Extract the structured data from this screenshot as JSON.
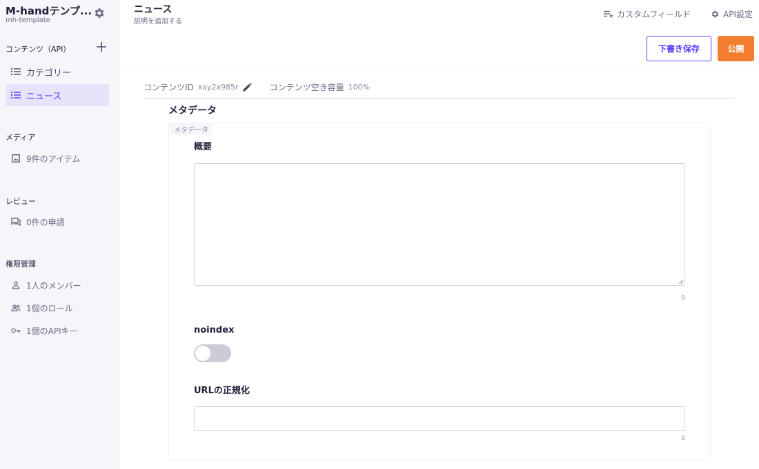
{
  "service": {
    "name": "M-handテンプ...",
    "id": "mh-template"
  },
  "sidebar": {
    "contents_heading": "コンテンツ（API）",
    "contents": [
      {
        "label": "カテゴリー",
        "icon": "list-icon"
      },
      {
        "label": "ニュース",
        "icon": "list-icon",
        "active": true
      }
    ],
    "media_heading": "メディア",
    "media_item": "9件のアイテム",
    "review_heading": "レビュー",
    "review_item": "0件の申請",
    "perm_heading": "権限管理",
    "perm_items": [
      {
        "label": "1人のメンバー",
        "icon": "person-icon"
      },
      {
        "label": "1個のロール",
        "icon": "group-icon"
      },
      {
        "label": "1個のAPIキー",
        "icon": "key-icon"
      }
    ]
  },
  "header": {
    "title": "ニュース",
    "subtitle": "説明を追加する",
    "custom_field": "カスタムフィールド",
    "api_settings": "API設定",
    "draft_button": "下書き保存",
    "publish_button": "公開"
  },
  "content_info": {
    "id_label": "コンテンツID",
    "id_value": "xay2x985r",
    "capacity_label": "コンテンツ空き容量",
    "capacity_value": "100%"
  },
  "metadata": {
    "title": "メタデータ",
    "tag": "メタデータ",
    "summary_label": "概要",
    "summary_value": "",
    "summary_count": "0",
    "noindex_label": "noindex",
    "noindex_on": false,
    "canonical_label": "URLの正規化",
    "canonical_value": "",
    "canonical_count": "0"
  },
  "colors": {
    "accent": "#563bff",
    "publish": "#f47e30",
    "sidebar_bg": "#f5f5fa"
  }
}
